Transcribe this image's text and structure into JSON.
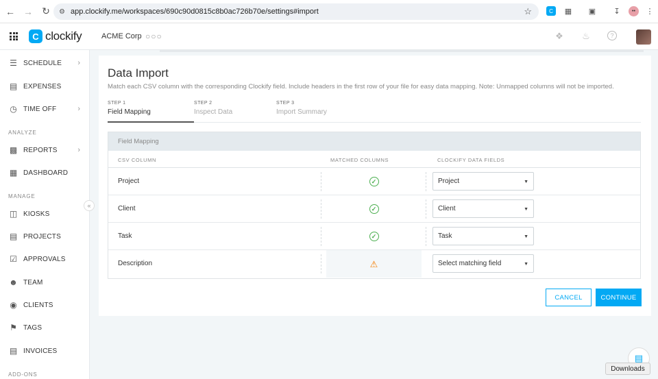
{
  "browser": {
    "url": "app.clockify.me/workspaces/690c90d0815c8b0ac726b70e/settings#import",
    "back_icon": "arrow-left",
    "forward_icon": "arrow-right",
    "reload_icon": "reload"
  },
  "header": {
    "logo_text": "clockify",
    "workspace": "ACME Corp"
  },
  "sidebar": {
    "items": [
      {
        "label": "SCHEDULE",
        "icon": "schedule-icon",
        "chevron": true
      },
      {
        "label": "EXPENSES",
        "icon": "expenses-icon",
        "chevron": false
      },
      {
        "label": "TIME OFF",
        "icon": "time-off-icon",
        "chevron": true
      },
      {
        "label": "REPORTS",
        "icon": "reports-icon",
        "chevron": true
      },
      {
        "label": "DASHBOARD",
        "icon": "dashboard-icon",
        "chevron": false
      },
      {
        "label": "KIOSKS",
        "icon": "kiosks-icon",
        "chevron": false
      },
      {
        "label": "PROJECTS",
        "icon": "projects-icon",
        "chevron": false
      },
      {
        "label": "APPROVALS",
        "icon": "approvals-icon",
        "chevron": false
      },
      {
        "label": "TEAM",
        "icon": "team-icon",
        "chevron": false
      },
      {
        "label": "CLIENTS",
        "icon": "clients-icon",
        "chevron": false
      },
      {
        "label": "TAGS",
        "icon": "tags-icon",
        "chevron": false
      },
      {
        "label": "INVOICES",
        "icon": "invoices-icon",
        "chevron": false
      }
    ],
    "sections": {
      "analyze": "ANALYZE",
      "manage": "MANAGE",
      "addons": "ADD-ONS"
    }
  },
  "main": {
    "title": "Data Import",
    "subtitle": "Match each CSV column with the corresponding Clockify field. Include headers in the first row of your file for easy data mapping. Note: Unmapped columns will not be imported.",
    "steps": [
      {
        "num": "STEP 1",
        "label": "Field Mapping",
        "active": true
      },
      {
        "num": "STEP 2",
        "label": "Inspect Data",
        "active": false
      },
      {
        "num": "STEP 3",
        "label": "Import Summary",
        "active": false
      }
    ],
    "table": {
      "section_title": "Field Mapping",
      "columns": [
        "CSV COLUMN",
        "MATCHED COLUMNS",
        "CLOCKIFY DATA FIELDS"
      ],
      "rows": [
        {
          "csv": "Project",
          "status": "matched",
          "field": "Project"
        },
        {
          "csv": "Client",
          "status": "matched",
          "field": "Client"
        },
        {
          "csv": "Task",
          "status": "matched",
          "field": "Task"
        },
        {
          "csv": "Description",
          "status": "warning",
          "field": "Select matching field"
        }
      ]
    },
    "cancel_label": "CANCEL",
    "continue_label": "CONTINUE"
  },
  "downloads": {
    "tooltip": "Downloads"
  },
  "colors": {
    "accent": "#03a9f4",
    "success": "#4caf50",
    "warning": "#f57c00"
  }
}
